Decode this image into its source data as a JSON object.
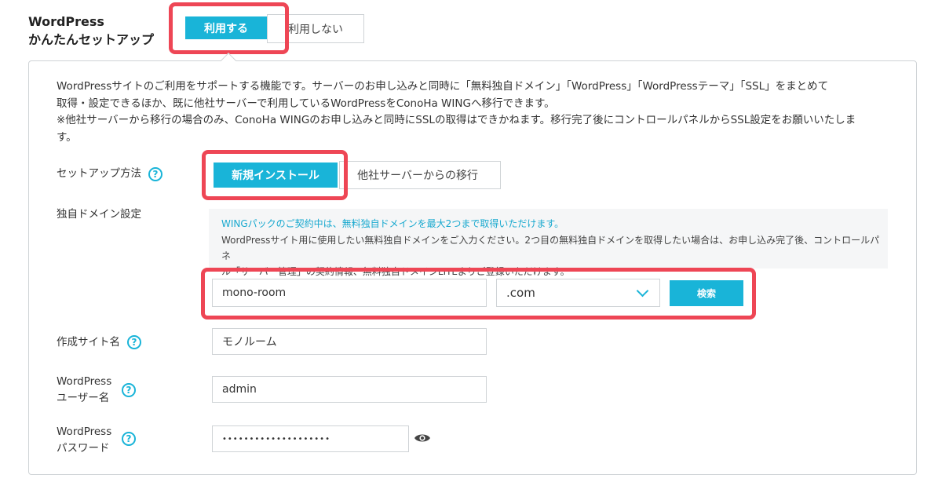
{
  "header": {
    "title_line1": "WordPress",
    "title_line2": "かんたんセットアップ",
    "toggle": {
      "use_label": "利用する",
      "not_use_label": "利用しない"
    }
  },
  "panel": {
    "description": "WordPressサイトのご利用をサポートする機能です。サーバーのお申し込みと同時に「無料独自ドメイン」「WordPress」「WordPressテーマ」「SSL」をまとめて\n取得・設定できるほか、既に他社サーバーで利用しているWordPressをConoHa WINGへ移行できます。\n※他社サーバーから移行の場合のみ、ConoHa WINGのお申し込みと同時にSSLの取得はできかねます。移行完了後にコントロールパネルからSSL設定をお願いいたしま\nす。",
    "setup_method": {
      "label": "セットアップ方法",
      "help": "?",
      "options": [
        "新規インストール",
        "他社サーバーからの移行"
      ]
    },
    "domain": {
      "label": "独自ドメイン設定",
      "info_line1": "WINGパックのご契約中は、無料独自ドメインを最大2つまで取得いただけます。",
      "info_line2": "WordPressサイト用に使用したい無料独自ドメインをご入力ください。2つ目の無料独自ドメインを取得したい場合は、お申し込み完了後、コントロールパネ\nル「サーバー管理」の契約情報、無料独自ドメインLITEよりご登録いただけます。",
      "value": "mono-room",
      "tld": ".com",
      "search_label": "検索"
    },
    "site_name": {
      "label": "作成サイト名",
      "help": "?",
      "value": "モノルーム"
    },
    "username": {
      "label_line1": "WordPress",
      "label_line2": "ユーザー名",
      "help": "?",
      "value": "admin"
    },
    "password": {
      "label_line1": "WordPress",
      "label_line2": "パスワード",
      "help": "?",
      "value": "••••••••••••••••••••"
    }
  },
  "colors": {
    "accent": "#19b4d8",
    "highlight": "#ee4655",
    "border": "#cfd3d6"
  },
  "icons": {
    "help": "question-circle-icon",
    "dropdown": "chevron-down-icon",
    "reveal": "eye-icon"
  }
}
